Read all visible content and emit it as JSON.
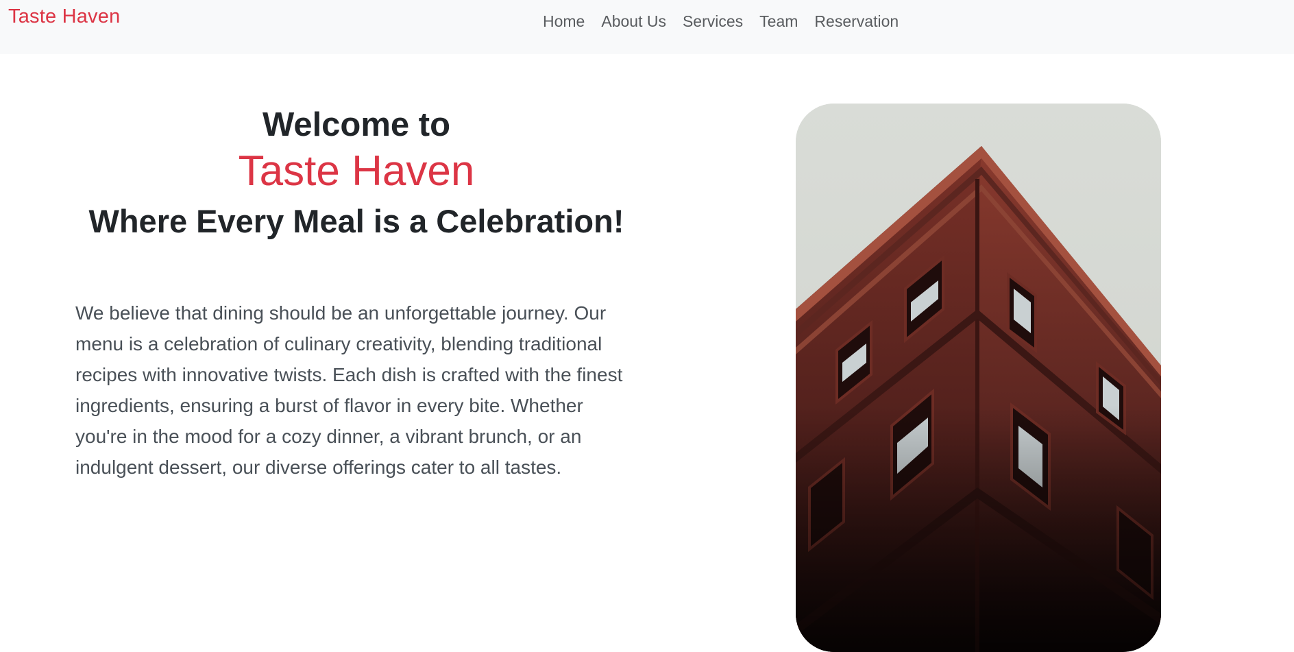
{
  "navbar": {
    "brand": "Taste Haven",
    "links": [
      {
        "label": "Home"
      },
      {
        "label": "About Us"
      },
      {
        "label": "Services"
      },
      {
        "label": "Team"
      },
      {
        "label": "Reservation"
      }
    ]
  },
  "hero": {
    "welcome": "Welcome to",
    "brand": "Taste Haven",
    "tagline": "Where Every Meal is a Celebration!",
    "intro": "We believe that dining should be an unforgettable journey. Our menu is a celebration of culinary creativity, blending traditional recipes with innovative twists. Each dish is crafted with the finest ingredients, ensuring a burst of flavor in every bite. Whether you're in the mood for a cozy dinner, a vibrant brunch, or an indulgent dessert, our diverse offerings cater to all tastes.",
    "image": {
      "subject": "red-brick-building-corner",
      "alt": ""
    }
  },
  "colors": {
    "accent": "#dc3545",
    "navbar_bg": "#f8f9fa",
    "text_dark": "#212529",
    "text_muted": "#495057",
    "sky": "#d8dbd6",
    "brick": "#6b2a24"
  }
}
